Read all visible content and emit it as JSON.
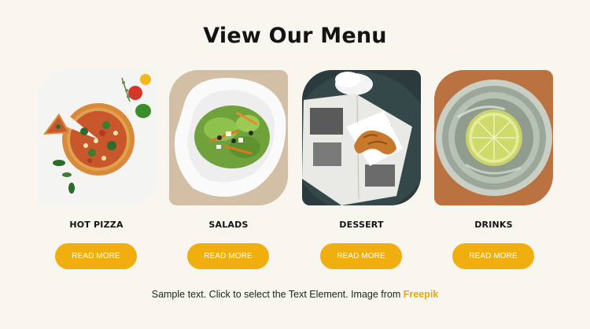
{
  "section": {
    "title": "View Our Menu"
  },
  "menu": {
    "items": [
      {
        "label": "HOT PIZZA",
        "button": "READ MORE",
        "image": "pizza-image"
      },
      {
        "label": "SALADS",
        "button": "READ MORE",
        "image": "salad-image"
      },
      {
        "label": "DESSERT",
        "button": "READ MORE",
        "image": "croissant-image"
      },
      {
        "label": "DRINKS",
        "button": "READ MORE",
        "image": "lime-drink-image"
      }
    ]
  },
  "caption": {
    "text": "Sample text. Click to select the Text Element. Image from ",
    "link": "Freepik"
  },
  "colors": {
    "background": "#f8f6ee",
    "accent": "#f0ae0f",
    "heading": "#141414",
    "link": "#e3a812"
  }
}
